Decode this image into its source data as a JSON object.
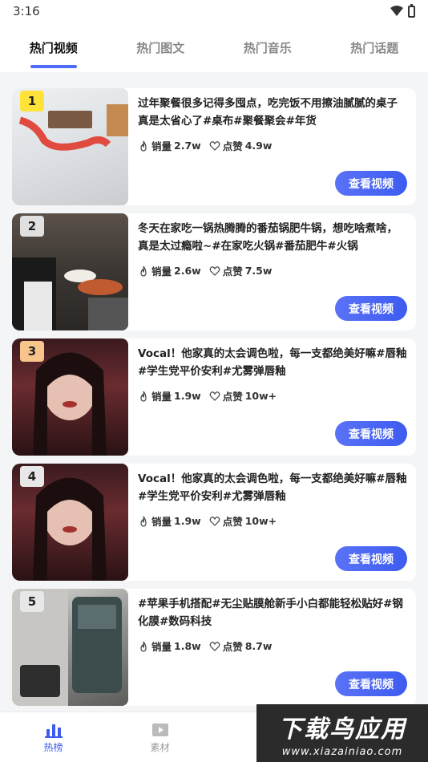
{
  "status": {
    "time": "3:16"
  },
  "tabs": [
    {
      "label": "热门视频",
      "active": true
    },
    {
      "label": "热门图文",
      "active": false
    },
    {
      "label": "热门音乐",
      "active": false
    },
    {
      "label": "热门话题",
      "active": false
    }
  ],
  "items": [
    {
      "rank": "1",
      "title": "过年聚餐很多记得多囤点，吃完饭不用擦油腻腻的桌子真是太省心了#桌布#聚餐聚会#年货",
      "sales_label": "销量",
      "sales": "2.7w",
      "likes_label": "点赞",
      "likes": "4.9w",
      "button": "查看视频",
      "badge_color": "#ffe23a"
    },
    {
      "rank": "2",
      "title": "冬天在家吃一锅热腾腾的番茄锅肥牛锅，想吃啥煮啥，真是太过瘾啦~#在家吃火锅#番茄肥牛#火锅",
      "sales_label": "销量",
      "sales": "2.6w",
      "likes_label": "点赞",
      "likes": "7.5w",
      "button": "查看视频",
      "badge_color": "#e0e0e0"
    },
    {
      "rank": "3",
      "title": "Vocal！他家真的太会调色啦，每一支都绝美好嘛#唇釉#学生党平价安利#尤雾弹唇釉",
      "sales_label": "销量",
      "sales": "1.9w",
      "likes_label": "点赞",
      "likes": "10w+",
      "button": "查看视频",
      "badge_color": "#f7c58b"
    },
    {
      "rank": "4",
      "title": "Vocal！他家真的太会调色啦，每一支都绝美好嘛#唇釉#学生党平价安利#尤雾弹唇釉",
      "sales_label": "销量",
      "sales": "1.9w",
      "likes_label": "点赞",
      "likes": "10w+",
      "button": "查看视频",
      "badge_color": "#e7e7e7"
    },
    {
      "rank": "5",
      "title": "#苹果手机搭配#无尘贴膜舱新手小白都能轻松贴好#钢化膜#数码科技",
      "sales_label": "销量",
      "sales": "1.8w",
      "likes_label": "点赞",
      "likes": "8.7w",
      "button": "查看视频",
      "badge_color": "#e7e7e7"
    }
  ],
  "nav": [
    {
      "label": "热榜",
      "icon": "bar-chart-icon",
      "active": true
    },
    {
      "label": "素材",
      "icon": "play-folder-icon",
      "active": false
    }
  ],
  "watermark": {
    "title": "下载鸟应用",
    "url": "www.xiazainiao.com"
  },
  "colors": {
    "accent": "#3d5cf0"
  }
}
